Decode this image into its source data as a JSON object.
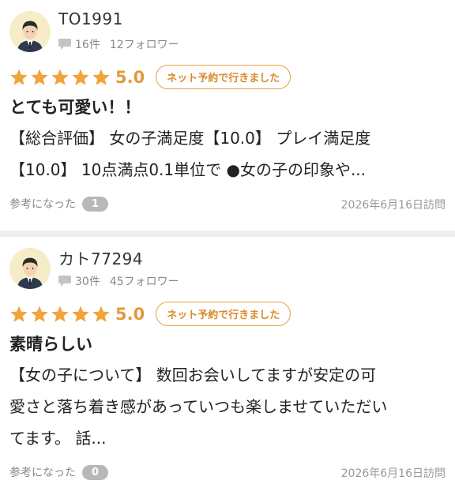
{
  "reviews": [
    {
      "username": "TO1991",
      "review_count": "16件",
      "followers": "12フォロワー",
      "rating": 5.0,
      "score_text": "5.0",
      "badge": "ネット予約で行きました",
      "title": "とても可愛い！！",
      "body_lines": [
        "【総合評価】 女の子満足度【10.0】 プレイ満足度",
        "【10.0】 10点満点0.1単位で ●女の子の印象や..."
      ],
      "helpful_label": "参考になった",
      "helpful_count": "1",
      "visit_date": "2026年6月16日訪問"
    },
    {
      "username": "カト77294",
      "review_count": "30件",
      "followers": "45フォロワー",
      "rating": 5.0,
      "score_text": "5.0",
      "badge": "ネット予約で行きました",
      "title": "素晴らしい",
      "body_lines": [
        "【女の子について】 数回お会いしてますが安定の可",
        "愛さと落ち着き感があっていつも楽しませていただい",
        "てます。 話..."
      ],
      "helpful_label": "参考になった",
      "helpful_count": "0",
      "visit_date": "2026年6月16日訪問"
    }
  ],
  "colors": {
    "star": "#f0a43a",
    "accent": "#e39a3b",
    "badge_border": "#e3a14a",
    "muted": "#888888",
    "count_bg": "#b8b8b8",
    "separator": "#eeeeee"
  },
  "icons": {
    "avatar": "user-avatar-icon",
    "review_count": "speech-bubble-icon",
    "rating": "star-icon"
  }
}
